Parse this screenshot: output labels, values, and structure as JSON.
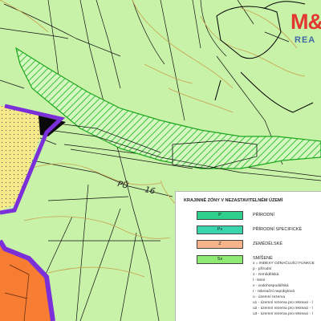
{
  "logo": {
    "top": "M&",
    "bottom": "REA"
  },
  "map_labels": {
    "road_number": "PŮ",
    "road_label": "16"
  },
  "legend": {
    "title": "KRAJINNÉ ZÓNY V NEZASTAVITELNÉM ÚZEMÍ",
    "items": [
      {
        "code": "P",
        "label": "PŘÍRODNÍ",
        "color": "#2fd08e"
      },
      {
        "code": "Px",
        "label": "PŘÍRODNÍ SPECIFICKÉ",
        "color": "#39d6ae"
      },
      {
        "code": "Z",
        "label": "ZEMĚDĚLSKÉ",
        "color": "#f7b48a"
      },
      {
        "code": "Sx",
        "label": "SMÍŠENÉ",
        "color": "#8fea74"
      }
    ],
    "index_heading": "x = INDEXY OZNAČUJÍCÍ FUNKCE",
    "index_lines": [
      "p - přírodní",
      "z - zemědělská",
      "l - lesní",
      "v - vodohospodářská",
      "r - rekreační nepobytová"
    ],
    "reserve_lines": [
      "u - územní rezerva",
      "u1 - územní rezerva pro rekreaci - l",
      "u2 - územní rezerva pro rekreaci - l",
      "u3 - územní rezerva pro rekreaci - l"
    ]
  },
  "colors": {
    "background": "#c8f2a8",
    "corridor_hatch": "#2fc92f",
    "boundary": "#7a2fd8",
    "yellow_zone": "#f7e786",
    "orange_zone": "#f77d32"
  }
}
